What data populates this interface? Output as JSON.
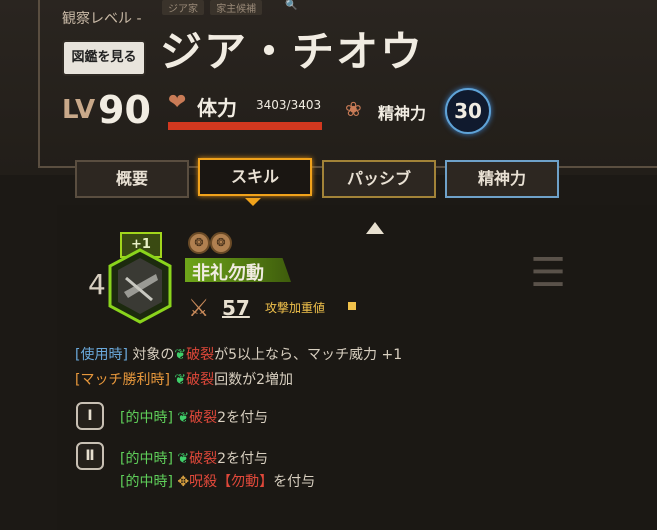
{
  "header": {
    "observation_label": "観察レベル -",
    "tags": [
      "ジア家",
      "家主候補"
    ],
    "zukan_button": "図鑑を見る",
    "character_name": "ジア・チオウ",
    "level_label": "LV",
    "level_value": "90",
    "hp_label": "体力",
    "hp_value": "3403/3403",
    "hp_fraction": 1.0,
    "sp_label": "精神力",
    "sp_value": "30"
  },
  "tabs": [
    {
      "label": "概要",
      "state": "normal"
    },
    {
      "label": "スキル",
      "state": "active"
    },
    {
      "label": "パッシブ",
      "state": "passive"
    },
    {
      "label": "精神力",
      "state": "mental"
    }
  ],
  "skill": {
    "count": "4",
    "plus_badge": "+1",
    "coin_count": 2,
    "name": "非礼勿動",
    "attack_value": "57",
    "attack_label": "攻撃加重値",
    "effects": {
      "use_tag": "[使用時]",
      "use_text_a": "対象の",
      "use_kw": "破裂",
      "use_text_b": "が5以上なら、マッチ威力 +1",
      "win_tag": "[マッチ勝利時]",
      "win_kw": "破裂",
      "win_text": "回数が2増加"
    },
    "coins": [
      {
        "numeral": "Ⅰ",
        "lines": [
          {
            "tag": "[的中時]",
            "kw": "破裂",
            "text": "2を付与"
          }
        ]
      },
      {
        "numeral": "Ⅱ",
        "lines": [
          {
            "tag": "[的中時]",
            "kw": "破裂",
            "text": "2を付与"
          },
          {
            "tag": "[的中時]",
            "kw": "呪殺【勿動】",
            "text": "を付与"
          }
        ]
      }
    ]
  },
  "colors": {
    "accent_orange": "#f0a21b",
    "green": "#8ad41c",
    "hp_red": "#d2381f",
    "sp_blue": "#5fa3d7"
  }
}
